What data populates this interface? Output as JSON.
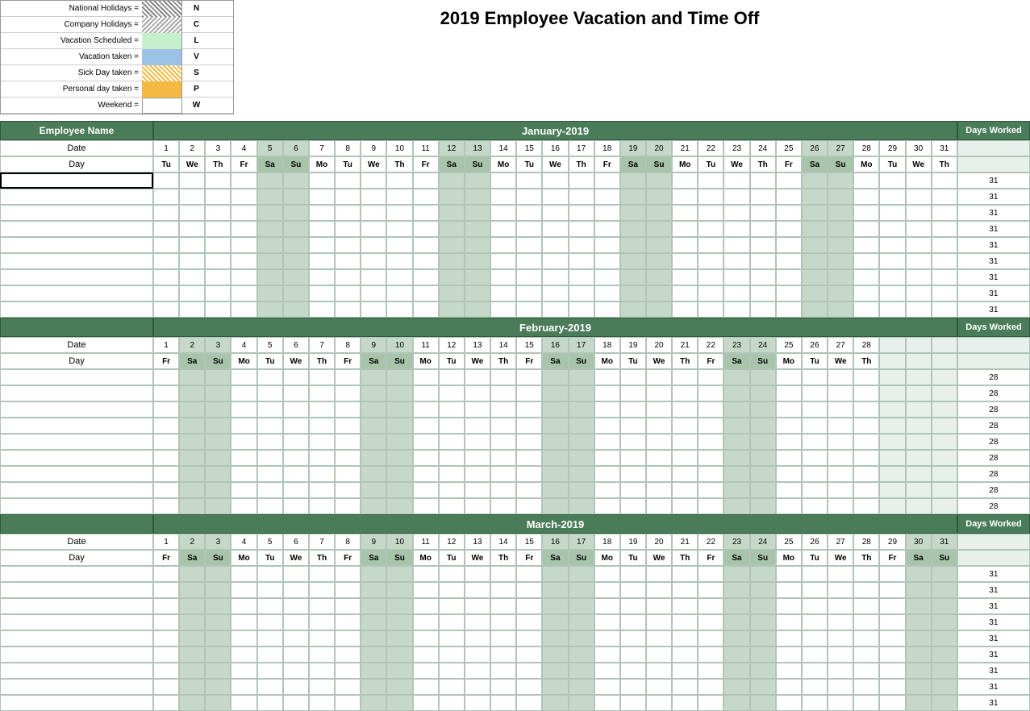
{
  "title": "2019 Employee Vacation and Time Off",
  "legend": {
    "items": [
      {
        "label": "National Holidays =",
        "code": "N",
        "swatch": "national"
      },
      {
        "label": "Company Holidays =",
        "code": "C",
        "swatch": "company"
      },
      {
        "label": "Vacation Scheduled =",
        "code": "L",
        "swatch": "vacation-sched"
      },
      {
        "label": "Vacation taken =",
        "code": "V",
        "swatch": "vacation-taken"
      },
      {
        "label": "Sick Day taken =",
        "code": "S",
        "swatch": "sick"
      },
      {
        "label": "Personal day taken =",
        "code": "P",
        "swatch": "personal"
      },
      {
        "label": "Weekend =",
        "code": "W",
        "swatch": "weekend"
      }
    ]
  },
  "months": [
    {
      "name": "January-2019",
      "days": 31,
      "days_worked": 31,
      "first_day": "Tu",
      "day_names": [
        "Tu",
        "We",
        "Th",
        "Fr",
        "Sa",
        "Su",
        "Mo",
        "Tu",
        "We",
        "Th",
        "Fr",
        "Sa",
        "Su",
        "Mo",
        "Tu",
        "We",
        "Th",
        "Fr",
        "Sa",
        "Su",
        "Mo",
        "Tu",
        "We",
        "Th",
        "Fr",
        "Sa",
        "Su",
        "Mo",
        "Tu",
        "We",
        "Th"
      ],
      "weekends": [
        5,
        6,
        12,
        13,
        19,
        20,
        26,
        27
      ]
    },
    {
      "name": "February-2019",
      "days": 28,
      "days_worked": 28,
      "first_day": "Fr",
      "day_names": [
        "Fr",
        "Sa",
        "Su",
        "Mo",
        "Tu",
        "We",
        "Th",
        "Fr",
        "Sa",
        "Su",
        "Mo",
        "Tu",
        "We",
        "Th",
        "Fr",
        "Sa",
        "Su",
        "Mo",
        "Tu",
        "We",
        "Th",
        "Fr",
        "Sa",
        "Su",
        "Mo",
        "Tu",
        "We",
        "Th",
        "",
        "",
        ""
      ],
      "weekends": [
        2,
        3,
        9,
        10,
        16,
        17,
        23,
        24
      ]
    },
    {
      "name": "March-2019",
      "days": 31,
      "days_worked": 31,
      "first_day": "Fr",
      "day_names": [
        "Fr",
        "Sa",
        "Su",
        "Mo",
        "Tu",
        "We",
        "Th",
        "Fr",
        "Sa",
        "Su",
        "Mo",
        "Tu",
        "We",
        "Th",
        "Fr",
        "Sa",
        "Su",
        "Mo",
        "Tu",
        "We",
        "Th",
        "Fr",
        "Sa",
        "Su",
        "Mo",
        "Tu",
        "We",
        "Th",
        "Fr",
        "Sa",
        "Su"
      ],
      "weekends": [
        2,
        3,
        9,
        10,
        16,
        17,
        23,
        24,
        30,
        31
      ]
    }
  ],
  "employees": [
    {
      "name": "",
      "active": true
    },
    {
      "name": ""
    },
    {
      "name": ""
    },
    {
      "name": ""
    },
    {
      "name": ""
    },
    {
      "name": ""
    },
    {
      "name": ""
    },
    {
      "name": ""
    },
    {
      "name": ""
    }
  ],
  "labels": {
    "employee_name": "Employee Name",
    "date": "Date",
    "day": "Day",
    "days_worked": "Days Worked"
  }
}
